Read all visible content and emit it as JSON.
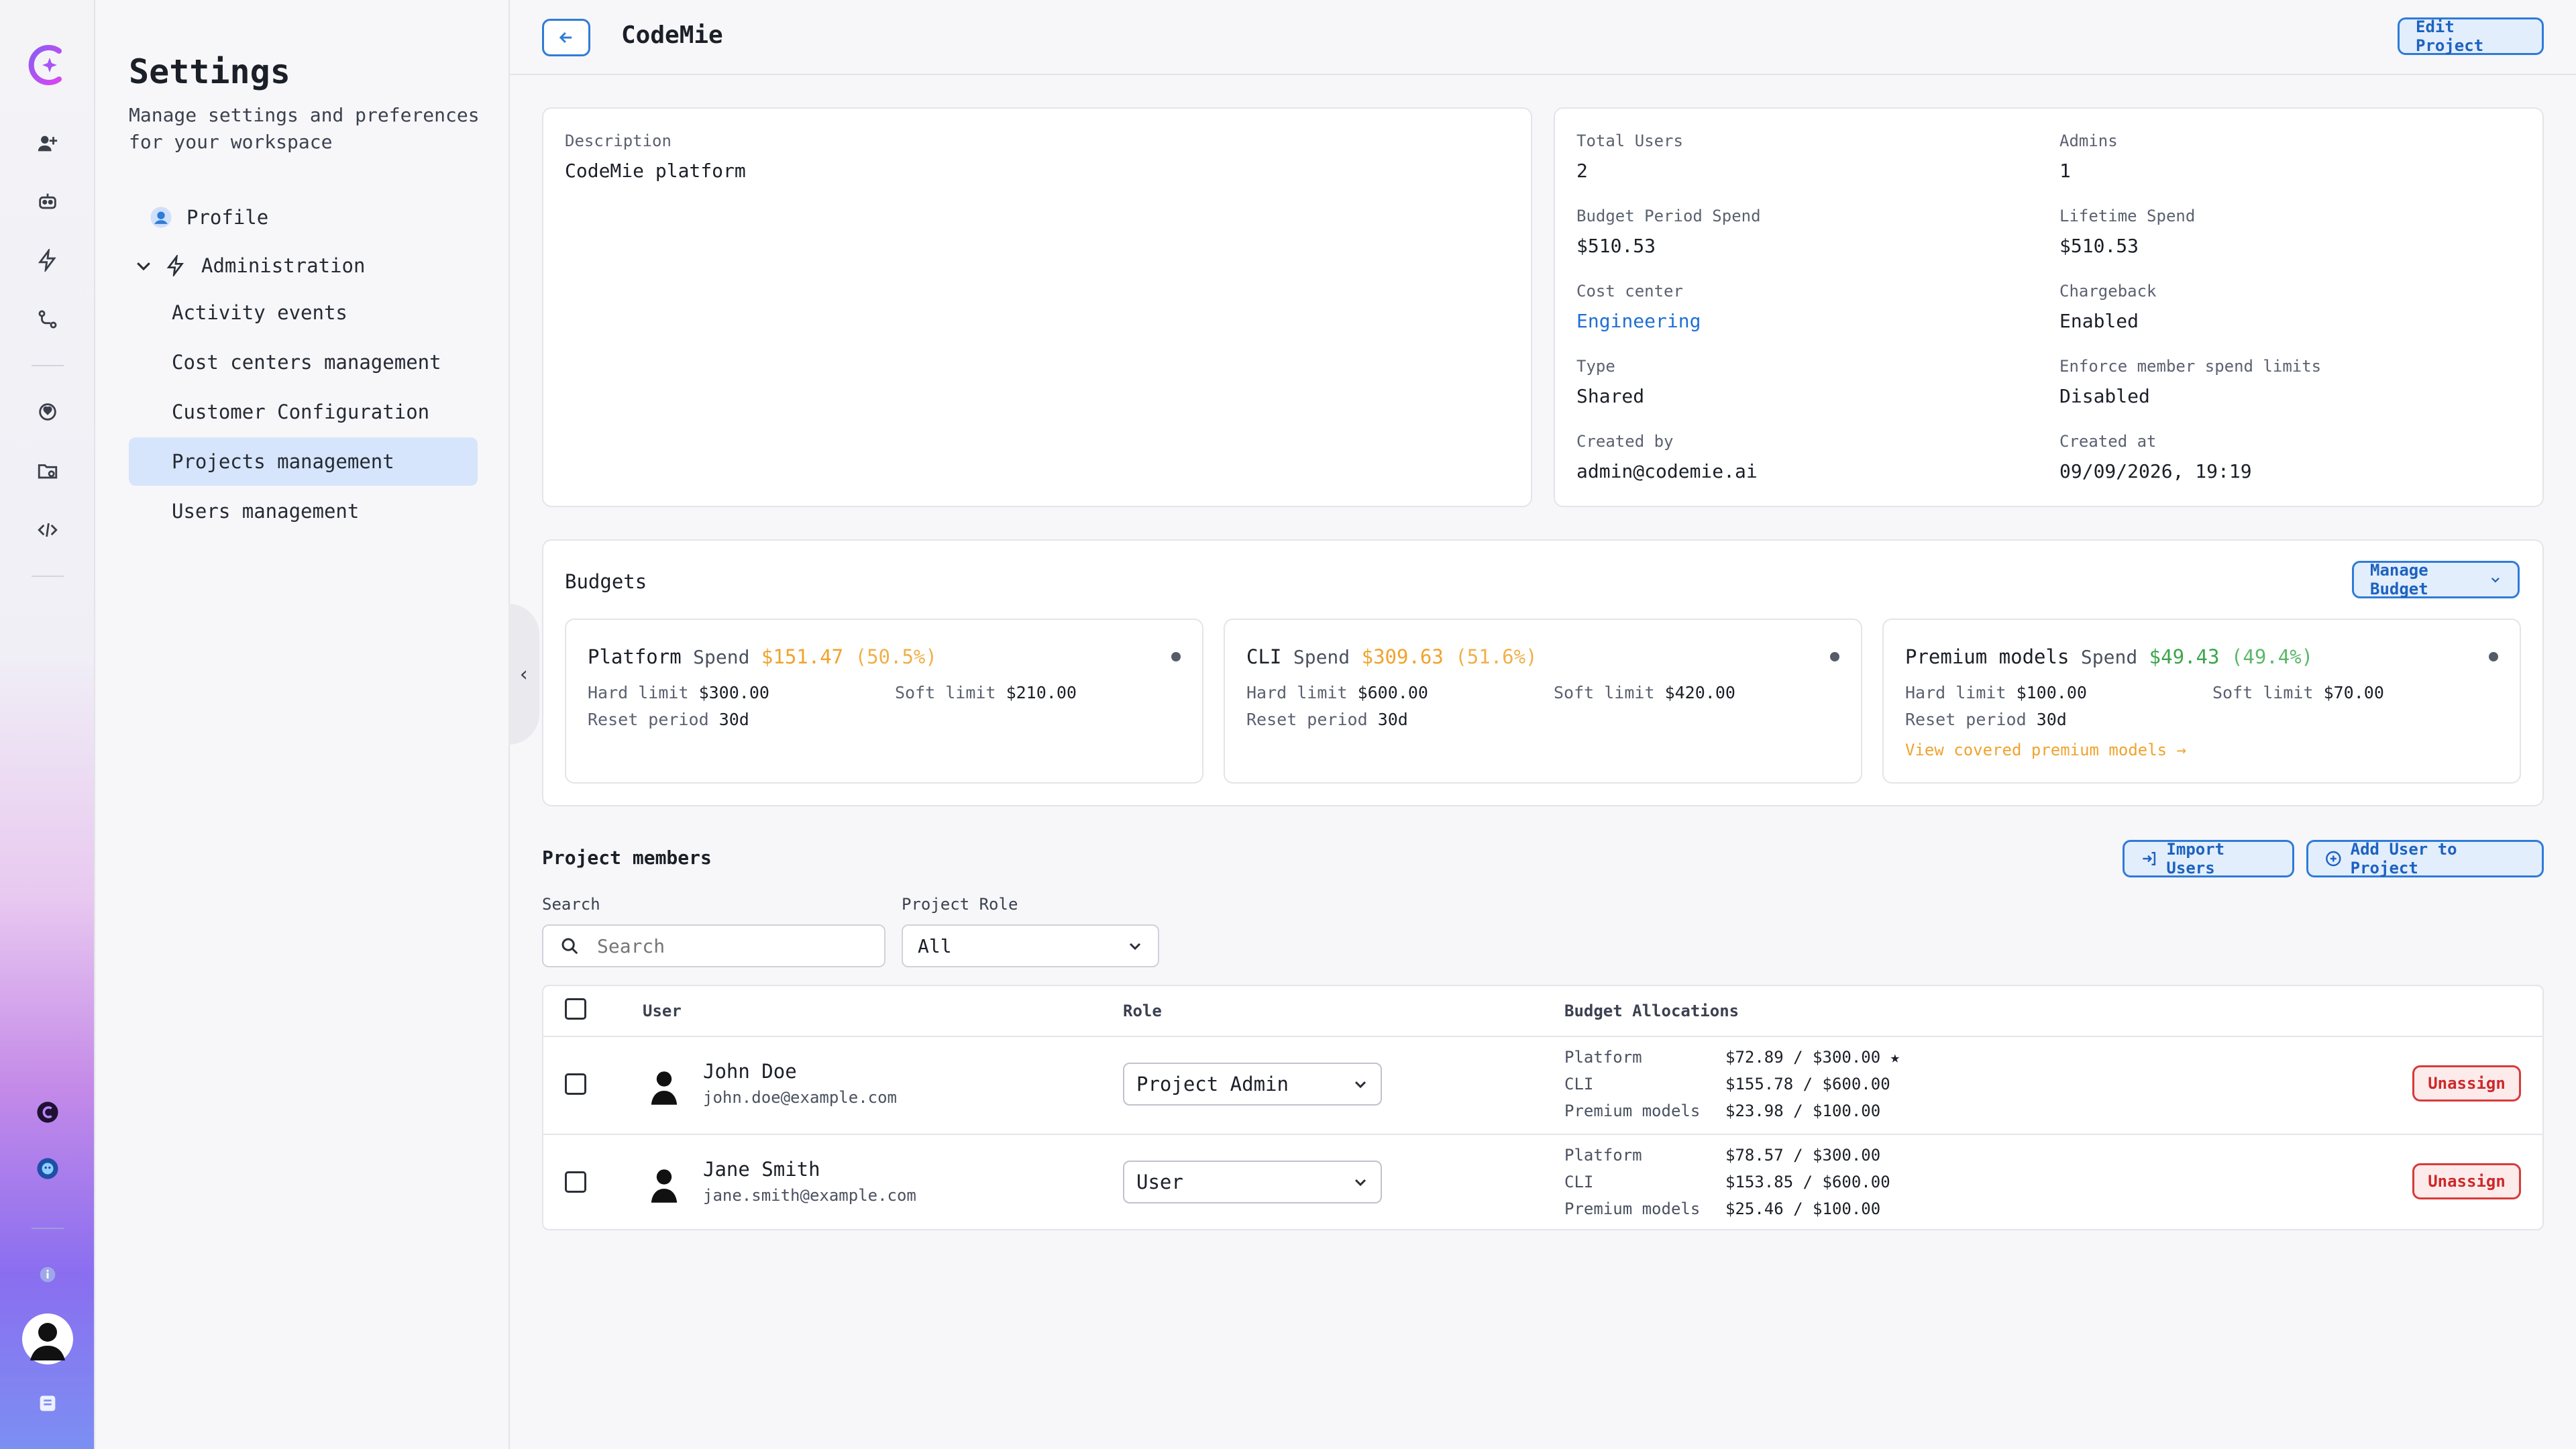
{
  "sidebar": {
    "title": "Settings",
    "subtitle": "Manage settings and preferences for your workspace",
    "items": [
      {
        "label": "Profile"
      },
      {
        "label": "Administration"
      },
      {
        "label": "Activity events"
      },
      {
        "label": "Cost centers management"
      },
      {
        "label": "Customer Configuration"
      },
      {
        "label": "Projects management"
      },
      {
        "label": "Users management"
      }
    ]
  },
  "header": {
    "title": "CodeMie",
    "edit_label": "Edit Project"
  },
  "project": {
    "description_label": "Description",
    "description": "CodeMie platform",
    "total_users_label": "Total Users",
    "total_users": "2",
    "admins_label": "Admins",
    "admins": "1",
    "budget_period_spend_label": "Budget Period Spend",
    "budget_period_spend": "$510.53",
    "lifetime_spend_label": "Lifetime Spend",
    "lifetime_spend": "$510.53",
    "cost_center_label": "Cost center",
    "cost_center": "Engineering",
    "chargeback_label": "Chargeback",
    "chargeback": "Enabled",
    "type_label": "Type",
    "type": "Shared",
    "enforce_label": "Enforce member spend limits",
    "enforce": "Disabled",
    "created_by_label": "Created by",
    "created_by": "admin@codemie.ai",
    "created_at_label": "Created at",
    "created_at": "09/09/2026, 19:19"
  },
  "budgets": {
    "title": "Budgets",
    "manage_label": "Manage Budget",
    "hard_label": "Hard limit",
    "soft_label": "Soft limit",
    "reset_label": "Reset period",
    "spend_word": "Spend",
    "cards": [
      {
        "name": "Platform",
        "spend": "$151.47",
        "pct": "(50.5%)",
        "hard": "$300.00",
        "soft": "$210.00",
        "reset": "30d",
        "color": "#f0a32d"
      },
      {
        "name": "CLI",
        "spend": "$309.63",
        "pct": "(51.6%)",
        "hard": "$600.00",
        "soft": "$420.00",
        "reset": "30d",
        "color": "#f0a32d"
      },
      {
        "name": "Premium models",
        "spend": "$49.43",
        "pct": "(49.4%)",
        "hard": "$100.00",
        "soft": "$70.00",
        "reset": "30d",
        "color": "#3aa64c",
        "link": "View covered premium models →"
      }
    ]
  },
  "members": {
    "title": "Project members",
    "import_label": "Import Users",
    "add_label": "Add User to Project",
    "search_label": "Search",
    "search_placeholder": "Search",
    "role_filter_label": "Project Role",
    "role_filter_value": "All",
    "columns": {
      "user": "User",
      "role": "Role",
      "budget": "Budget Allocations"
    },
    "unassign_label": "Unassign",
    "rows": [
      {
        "name": "John Doe",
        "email": "john.doe@example.com",
        "role": "Project Admin",
        "alloc": [
          {
            "label": "Platform",
            "amount": "$72.89 / $300.00"
          },
          {
            "label": "CLI",
            "amount": "$155.78 / $600.00"
          },
          {
            "label": "Premium models",
            "amount": "$23.98 / $100.00"
          }
        ]
      },
      {
        "name": "Jane Smith",
        "email": "jane.smith@example.com",
        "role": "User",
        "alloc": [
          {
            "label": "Platform",
            "amount": "$78.57 / $300.00"
          },
          {
            "label": "CLI",
            "amount": "$153.85 / $600.00"
          },
          {
            "label": "Premium models",
            "amount": "$25.46 / $100.00"
          }
        ]
      }
    ]
  }
}
